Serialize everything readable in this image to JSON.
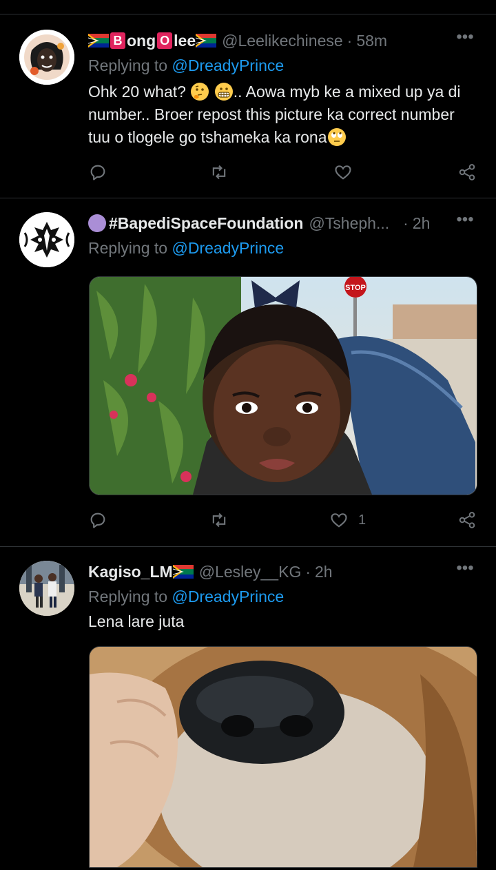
{
  "tweets": [
    {
      "name_parts": [
        "B",
        "ong",
        "O",
        "lee"
      ],
      "handle": "@Leelikechinese",
      "time": "58m",
      "replying_prefix": "Replying to",
      "replying_mention": "@DreadyPrince",
      "text_1": "Ohk 20 what?",
      "text_2": ".. Aowa myb ke a mixed up ya di number.. Broer repost this picture ka correct number tuu o tlogele go tshameka ka rona",
      "like_count": ""
    },
    {
      "name": "#BapediSpaceFoundation",
      "handle": "@Tsheph...",
      "time": "2h",
      "replying_prefix": "Replying to",
      "replying_mention": "@DreadyPrince",
      "like_count": "1",
      "media_sign": "STOP"
    },
    {
      "name": "Kagiso_LM",
      "handle": "@Lesley__KG",
      "time": "2h",
      "replying_prefix": "Replying to",
      "replying_mention": "@DreadyPrince",
      "text": "Lena lare juta"
    }
  ],
  "icons": {
    "reply": "reply-icon",
    "retweet": "retweet-icon",
    "like": "heart-icon",
    "share": "share-icon",
    "more": "more-icon"
  },
  "colors": {
    "background": "#000000",
    "mention": "#1d9bf0",
    "muted": "#71767b",
    "divider": "#2f3336"
  }
}
